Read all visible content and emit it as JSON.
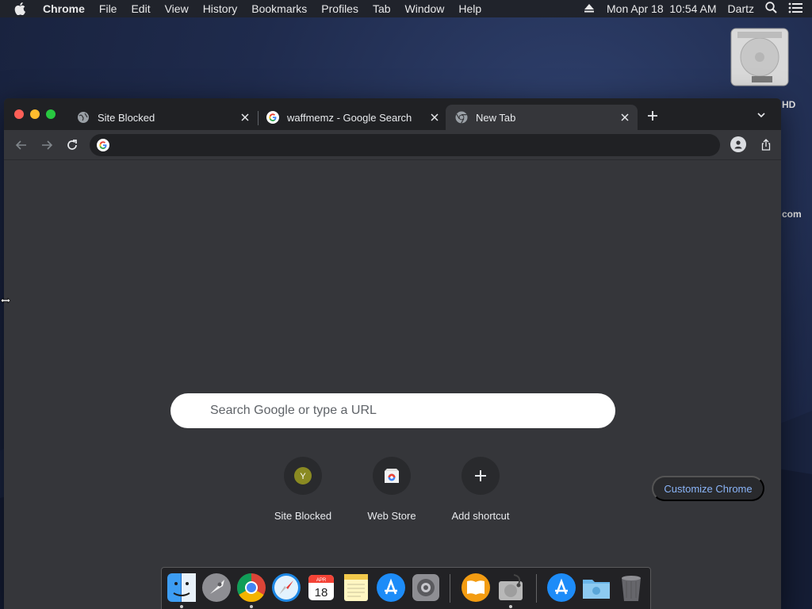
{
  "menubar": {
    "app_name": "Chrome",
    "menus": [
      "File",
      "Edit",
      "View",
      "History",
      "Bookmarks",
      "Profiles",
      "Tab",
      "Window",
      "Help"
    ],
    "clock": "Mon Apr 18  10:54 AM",
    "user": "Dartz"
  },
  "desktop": {
    "hd_label": "HD",
    "com_label": "com"
  },
  "browser": {
    "tabs": [
      {
        "label": "Site Blocked",
        "favicon": "globe-icon"
      },
      {
        "label": "waffmemz - Google Search",
        "favicon": "google-g-icon"
      },
      {
        "label": "New Tab",
        "favicon": "chrome-icon",
        "active": true
      }
    ],
    "omnibox": {
      "value": "",
      "placeholder": ""
    },
    "ntp": {
      "search_placeholder": "Search Google or type a URL",
      "shortcuts": [
        {
          "label": "Site Blocked",
          "icon_letter": "Y",
          "icon_color": "#8a8a22"
        },
        {
          "label": "Web Store",
          "icon": "web-store-icon"
        },
        {
          "label": "Add shortcut",
          "icon": "plus-icon"
        }
      ],
      "customize_label": "Customize Chrome"
    }
  },
  "dock": {
    "calendar_month": "APR",
    "calendar_day": "18"
  },
  "colors": {
    "accent_link": "#8ab4f8",
    "window_bg": "#35363a",
    "tabstrip_bg": "#202124"
  }
}
